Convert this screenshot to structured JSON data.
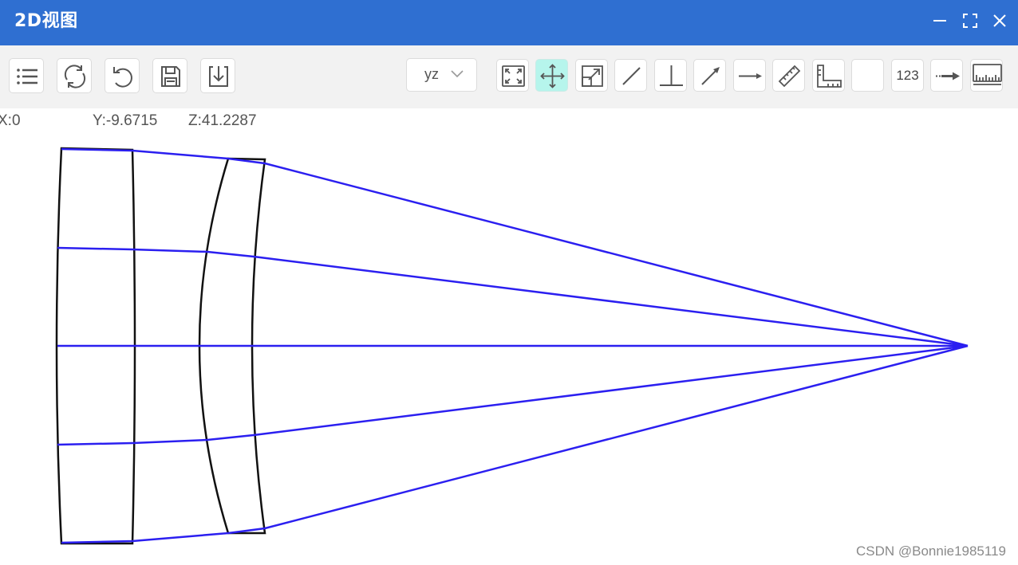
{
  "window": {
    "title": "2D视图",
    "controls": [
      "minimize-icon",
      "maximize-icon",
      "close-icon"
    ]
  },
  "toolbar": {
    "left_buttons": [
      "list-icon",
      "refresh-icon",
      "undo-icon",
      "save-icon",
      "download-icon"
    ],
    "view_select": {
      "value": "yz"
    },
    "tools": [
      "fit-view-icon",
      "pan-icon",
      "zoom-window-icon",
      "line-icon",
      "perpendicular-icon",
      "arrow-line-icon",
      "horizontal-arrow-icon",
      "ruler-icon",
      "angle-ruler-icon",
      "blank-tool",
      "number-label",
      "dashed-arrow-icon",
      "scale-bar-icon"
    ],
    "number_label": "123",
    "active_tool": "pan-icon"
  },
  "coordinates": {
    "x": "X:0",
    "y": "Y:-9.6715",
    "z": "Z:41.2287"
  },
  "colors": {
    "titlebar": "#2f6fd1",
    "ray": "#2b1ff0",
    "lens": "#111111",
    "active_tool": "#b6f5ec"
  },
  "watermark": "CSDN @Bonnie1985119"
}
